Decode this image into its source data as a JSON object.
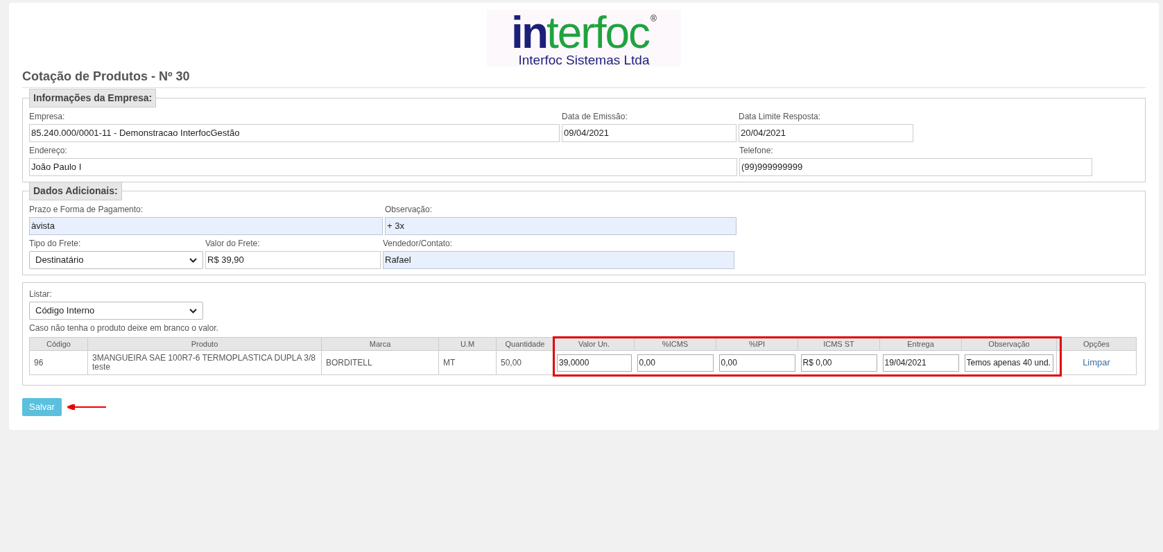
{
  "logo": {
    "mark_dark": "in",
    "mark_light": "terfoc",
    "registered": "®",
    "tagline": "Interfoc Sistemas Ltda"
  },
  "title": "Cotação de Produtos - Nº 30",
  "company_info": {
    "legend": "Informações da Empresa:",
    "fields": [
      {
        "kind": "text",
        "label": "Empresa:",
        "value": "85.240.000/0001-11 - Demonstracao InterfocGestão",
        "autofill": false
      },
      {
        "kind": "text",
        "label": "Data de Emissão:",
        "value": "09/04/2021",
        "autofill": false
      },
      {
        "kind": "text",
        "label": "Data Limite Resposta:",
        "value": "20/04/2021",
        "autofill": false
      },
      {
        "kind": "text",
        "label": "Endereço:",
        "value": "João Paulo I",
        "autofill": false
      },
      {
        "kind": "text",
        "label": "Telefone:",
        "value": "(99)999999999",
        "autofill": false
      }
    ]
  },
  "additional": {
    "legend": "Dados Adicionais:",
    "fields": [
      {
        "kind": "text",
        "label": "Prazo e Forma de Pagamento:",
        "value": "àvista",
        "autofill": true
      },
      {
        "kind": "text",
        "label": "Observação:",
        "value": "+ 3x",
        "autofill": true
      },
      {
        "kind": "select",
        "label": "Tipo do Frete:",
        "value": "Destinatário"
      },
      {
        "kind": "text",
        "label": "Valor do Frete:",
        "value": "R$ 39,90",
        "autofill": false
      },
      {
        "kind": "text",
        "label": "Vendedor/Contato:",
        "value": "Rafael",
        "autofill": true
      }
    ]
  },
  "listing": {
    "label": "Listar:",
    "value": "Código Interno",
    "hint": "Caso não tenha o produto deixe em branco o valor.",
    "table": {
      "columns": [
        "Código",
        "Produto",
        "Marca",
        "U.M",
        "Quantidade",
        "Valor Un.",
        "%ICMS",
        "%IPI",
        "ICMS ST",
        "Entrega",
        "Observação",
        "Opções"
      ],
      "rows": [
        {
          "cells": [
            {
              "kind": "text",
              "value": "96"
            },
            {
              "kind": "text",
              "value": "3MANGUEIRA SAE 100R7-6 TERMOPLASTICA DUPLA 3/8\nteste"
            },
            {
              "kind": "text",
              "value": "BORDITELL"
            },
            {
              "kind": "text",
              "value": "MT"
            },
            {
              "kind": "text",
              "value": "50,00"
            },
            {
              "kind": "input",
              "value": "39,0000"
            },
            {
              "kind": "input",
              "value": "0,00"
            },
            {
              "kind": "input",
              "value": "0,00"
            },
            {
              "kind": "input",
              "value": "R$ 0,00"
            },
            {
              "kind": "input",
              "value": "19/04/2021"
            },
            {
              "kind": "input",
              "value": "Temos apenas 40 und."
            },
            {
              "kind": "link",
              "value": "Limpar"
            }
          ]
        }
      ]
    }
  },
  "save_button": "Salvar"
}
